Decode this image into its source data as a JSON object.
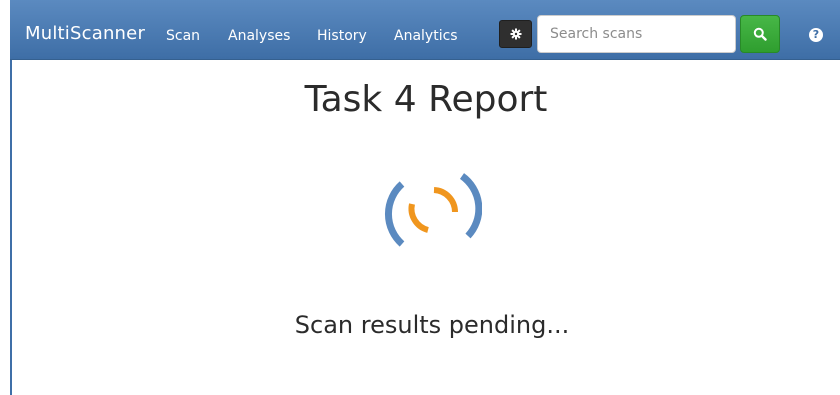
{
  "navbar": {
    "brand": "MultiScanner",
    "items": [
      {
        "label": "Scan"
      },
      {
        "label": "Analyses"
      },
      {
        "label": "History"
      },
      {
        "label": "Analytics"
      }
    ],
    "settings_icon": "gear-icon",
    "search": {
      "placeholder": "Search scans",
      "value": "",
      "button_icon": "search-icon"
    },
    "help_icon": "question-circle-icon"
  },
  "main": {
    "title": "Task 4 Report",
    "spinner_icon": "loading-spinner-icon",
    "status": "Scan results pending..."
  },
  "colors": {
    "navbar": "#4a7ab4",
    "search_button": "#3aa83a",
    "spinner_outer": "#5b8ac0",
    "spinner_inner": "#f0961e"
  }
}
